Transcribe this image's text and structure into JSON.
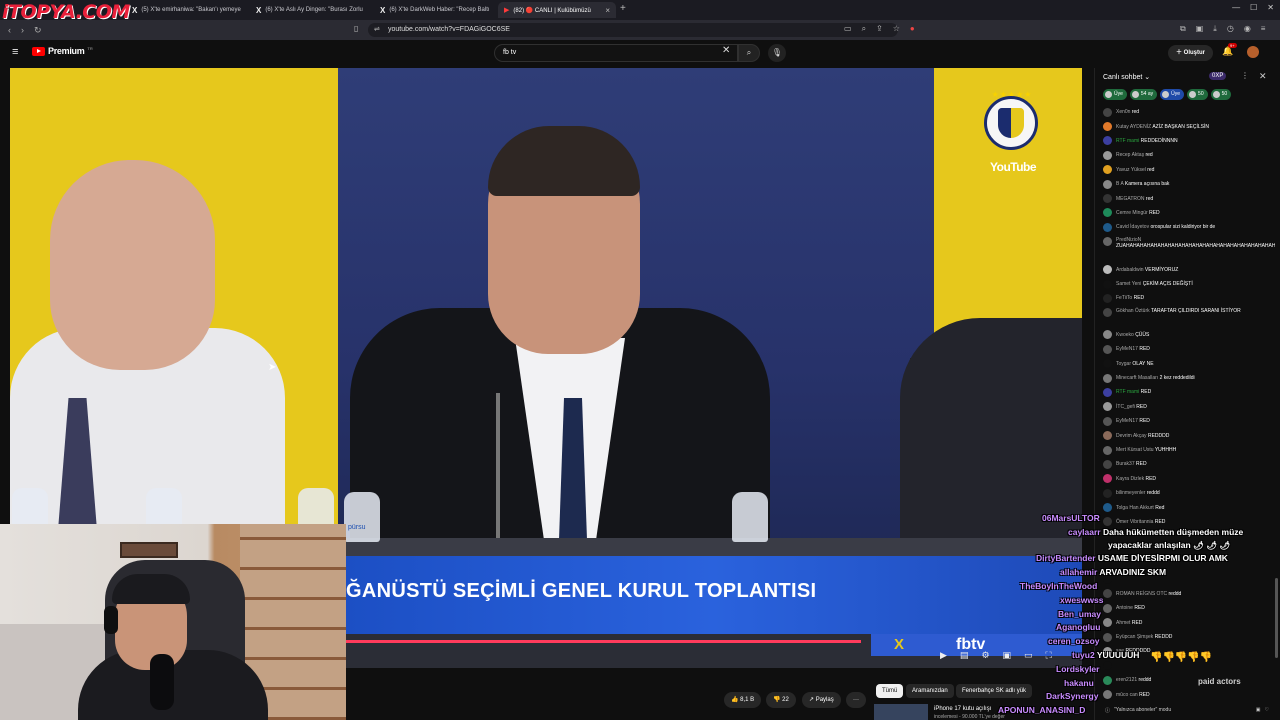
{
  "browser": {
    "brand_watermark": "iTOPYA.COM",
    "tabs": [
      {
        "title": "(5) X'te emirhaniwa: \"Bakan'ı yemeye",
        "active": false
      },
      {
        "title": "(6) X'te Aslı Ay Dingen: \"Burası Zorlu",
        "active": false
      },
      {
        "title": "(6) X'te DarkWeb Haber: \"Recep Baltı",
        "active": false
      },
      {
        "title": "(82) 🔴 CANLI | Kulübümüzü",
        "active": true
      }
    ],
    "new_tab": "+",
    "url": "youtube.com/watch?v=FDAGiGOC6SE"
  },
  "youtube": {
    "logo_text": "Premium",
    "logo_sup": "TR",
    "search_value": "fb tv",
    "create_label": "Oluştur",
    "notif_count": "9+"
  },
  "video": {
    "lower_third": "ĞANÜSTÜ SEÇİMLİ GENEL KURUL TOPLANTISI",
    "channel_bug": "fbtv",
    "corner_logo_text": "YouTube",
    "bottle_label": "pürsu"
  },
  "below_video": {
    "like_count": "8,1 B",
    "comment_count": "22",
    "share_label": "Paylaş",
    "more_label": "···",
    "chips": [
      {
        "label": "Tümü",
        "active": true
      },
      {
        "label": "Aramanızdan",
        "active": false
      },
      {
        "label": "Fenerbahçe SK adlı yük",
        "active": false
      }
    ],
    "rec_title": "iPhone 17 kutu açılışı",
    "rec_sub": "incelemesi - 90.000 TL'ye değer"
  },
  "chat": {
    "title": "Canlı sohbet",
    "xp": "0XP",
    "badges": [
      {
        "label": "Üye",
        "color": "#1f6a3c"
      },
      {
        "label": "54 ay",
        "color": "#1f6a3c"
      },
      {
        "label": "Üye",
        "color": "#1f4aa8"
      },
      {
        "label": "50",
        "color": "#1f6a3c"
      },
      {
        "label": "50",
        "color": "#1f6a3c"
      }
    ],
    "messages": [
      {
        "name": "Xen0n",
        "text": "red",
        "avatar": "#444",
        "member": false
      },
      {
        "name": "Kutay AYDENİZ",
        "text": "AZİZ BAŞKAN SEÇİLSİN",
        "avatar": "#e0792a",
        "member": false
      },
      {
        "name": "RTF mami",
        "text": "REDDEDİNNNN",
        "avatar": "#3c3fa0",
        "member": true
      },
      {
        "name": "Recep Aktaş",
        "text": "red",
        "avatar": "#999",
        "member": false
      },
      {
        "name": "Yavuz Yüksel",
        "text": "red",
        "avatar": "#e0a020",
        "member": false
      },
      {
        "name": "B A",
        "text": "Kamera açısına bak",
        "avatar": "#888",
        "member": false
      },
      {
        "name": "MEGATRON",
        "text": "red",
        "avatar": "#333",
        "member": false
      },
      {
        "name": "Cemre Mingür",
        "text": "RED",
        "avatar": "#1e8a5a",
        "member": false
      },
      {
        "name": "Cavid İdayetov",
        "text": "orospular sizi kaldiriyor bir de",
        "avatar": "#1e5a8a",
        "member": false
      },
      {
        "name": "PredNizioN",
        "text": "ZUAHAHAHAHAHAHAHAHAHAHAHAHAHAHAHAHAHAHAHAHAHAHAHAHAHAHAHAH",
        "avatar": "#666",
        "member": false,
        "tall": true
      },
      {
        "name": "Ardabaldwin",
        "text": "VERMİYORUZ",
        "avatar": "#bbb",
        "member": false
      },
      {
        "name": "Samet Yeni",
        "text": "ÇEKİM AÇIS DEĞİŞTİ",
        "avatar": "#111",
        "member": false
      },
      {
        "name": "FeTiiTo",
        "text": "RED",
        "avatar": "#222",
        "member": false
      },
      {
        "name": "Gökhan Öztürk",
        "text": "TARAFTAR ÇILDIRDI SARANI İSTİYOR",
        "avatar": "#444",
        "member": false,
        "tall2": true
      },
      {
        "name": "Kwoeko",
        "text": "ÇÜÜS",
        "avatar": "#888",
        "member": false
      },
      {
        "name": "EyMeN17",
        "text": "RED",
        "avatar": "#555",
        "member": false
      },
      {
        "name": "Toygar",
        "text": "OLAY NE",
        "avatar": "#111",
        "member": false
      },
      {
        "name": "Minecarft Masalları",
        "text": "2 kez reddedildi",
        "avatar": "#777",
        "member": false
      },
      {
        "name": "RTF mami",
        "text": "RED",
        "avatar": "#3c3fa0",
        "member": true
      },
      {
        "name": "İTC_gefi",
        "text": "RED",
        "avatar": "#999",
        "member": false
      },
      {
        "name": "EyMeN17",
        "text": "RED",
        "avatar": "#555",
        "member": false
      },
      {
        "name": "Devrim Akçay",
        "text": "REDDDD",
        "avatar": "#8a6a5a",
        "member": false
      },
      {
        "name": "Mert Kürsat Ustu",
        "text": "YUHHHH",
        "avatar": "#666",
        "member": false
      },
      {
        "name": "Burak37",
        "text": "RED",
        "avatar": "#444",
        "member": false
      },
      {
        "name": "Kayra Dizlek",
        "text": "RED",
        "avatar": "#c0306a",
        "member": false
      },
      {
        "name": "bilinmeyenler",
        "text": "reddd",
        "avatar": "#222",
        "member": false
      },
      {
        "name": "Tolga Han Akkurt",
        "text": "Red",
        "avatar": "#1e5a8a",
        "member": false
      },
      {
        "name": "Ömer Vibritannia",
        "text": "RED",
        "avatar": "#333",
        "member": false
      },
      {
        "name": "",
        "text": "",
        "avatar": "#0f0f0f",
        "member": false
      },
      {
        "name": "",
        "text": "",
        "avatar": "#0f0f0f",
        "member": false
      },
      {
        "name": "",
        "text": "",
        "avatar": "#0f0f0f",
        "member": false
      },
      {
        "name": "",
        "text": "",
        "avatar": "#0f0f0f",
        "member": false
      },
      {
        "name": "ROMAN REİGNS OTC",
        "text": "reddd",
        "avatar": "#444",
        "member": false
      },
      {
        "name": "Antoine",
        "text": "RED",
        "avatar": "#666",
        "member": false
      },
      {
        "name": "Ahmet",
        "text": "RED",
        "avatar": "#888",
        "member": false
      },
      {
        "name": "Eyüpcan Şimşek",
        "text": "REDDD",
        "avatar": "#555",
        "member": false
      },
      {
        "name": "sae",
        "text": "REDDDDD",
        "avatar": "#999",
        "member": false
      },
      {
        "name": "",
        "text": "",
        "avatar": "#0f0f0f",
        "member": false
      },
      {
        "name": "eren2121",
        "text": "reddd",
        "avatar": "#2a8a5a",
        "member": false
      },
      {
        "name": "mûco can",
        "text": "RED",
        "avatar": "#777",
        "member": false
      }
    ],
    "input_placeholder": "\"Yalnızca aboneler\" modu",
    "emoji_row": "👎👎👎👎👎"
  },
  "overlay_chat": {
    "lines": [
      {
        "name": "06MarsULTOR",
        "text": ""
      },
      {
        "name": "caylaarr",
        "text": "Daha hükümetten düşmeden müze"
      },
      {
        "name": "",
        "text": "yapacaklar anlaşılan 🌶 🌶 🌶"
      },
      {
        "name": "DirtyBartender",
        "text": "USAME DİYESİRPMI OLUR AMK"
      },
      {
        "name": "allahemir",
        "text": "ARVADINIZ SKM"
      },
      {
        "name": "TheBoyInTheWood",
        "text": ""
      },
      {
        "name": "xweswwss",
        "text": ""
      },
      {
        "name": "Ben_umay",
        "text": ""
      },
      {
        "name": "Aganogluu",
        "text": ""
      },
      {
        "name": "ceren_ozsoy",
        "text": ""
      },
      {
        "name": "tuyu2",
        "text": "YUUUUUH"
      },
      {
        "name": "Lordskyler",
        "text": ""
      },
      {
        "name": "hakanu",
        "text": ""
      },
      {
        "name": "DarkSynergy",
        "text": ""
      },
      {
        "name": "APONUN_ANASINI_D",
        "text": ""
      }
    ],
    "paid_actors": "paid actors"
  }
}
